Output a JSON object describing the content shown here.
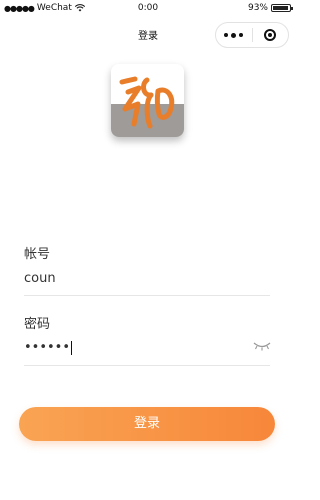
{
  "status_bar": {
    "carrier": "WeChat",
    "time": "0:00",
    "battery_percent": "93%",
    "battery_level": 0.93
  },
  "nav": {
    "title": "登录"
  },
  "form": {
    "account_label": "帐号",
    "account_value": "coun",
    "password_label": "密码",
    "password_value": "••••••"
  },
  "login_button_label": "登录",
  "colors": {
    "accent_start": "#f9a453",
    "accent_end": "#f7873a",
    "logo_mark": "#e87e2a",
    "logo_bg_bottom": "#9e9b98"
  },
  "icons": {
    "more": "more-dots-icon",
    "close": "mini-program-close-icon",
    "password_toggle": "eye-closed-icon",
    "wifi": "wifi-icon",
    "battery": "battery-icon"
  }
}
